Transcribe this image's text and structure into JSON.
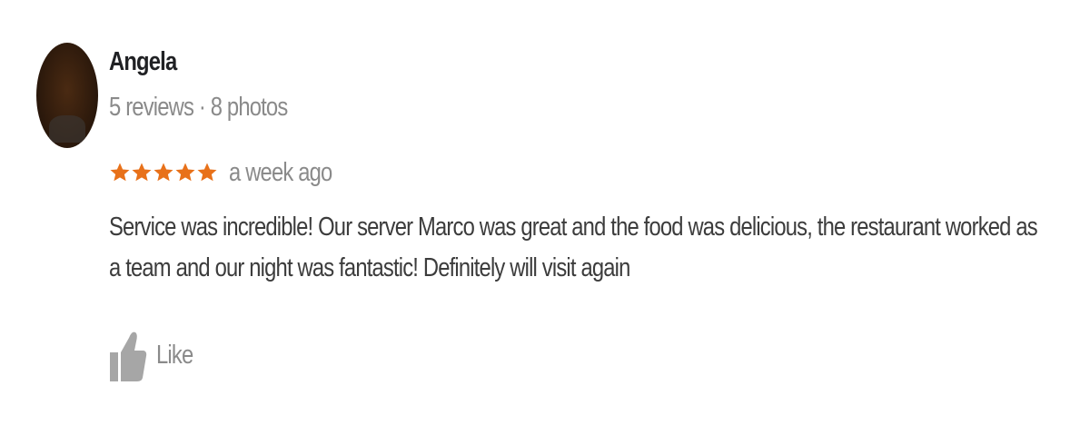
{
  "review": {
    "author": "Angela",
    "author_meta": "5 reviews · 8 photos",
    "rating": 5,
    "rating_max": 5,
    "time_ago": "a week ago",
    "text": "Service was incredible! Our server Marco was great and the food was delicious, the restaurant worked as a team and our night was fantastic! Definitely will visit again",
    "like_label": "Like"
  },
  "colors": {
    "star": "#e8711a",
    "author": "#202124",
    "meta": "#8a8a8a",
    "body_text": "#3c3c3c"
  },
  "icons": {
    "avatar": "avatar-photo",
    "star": "star-icon",
    "like": "thumbs-up-icon"
  }
}
